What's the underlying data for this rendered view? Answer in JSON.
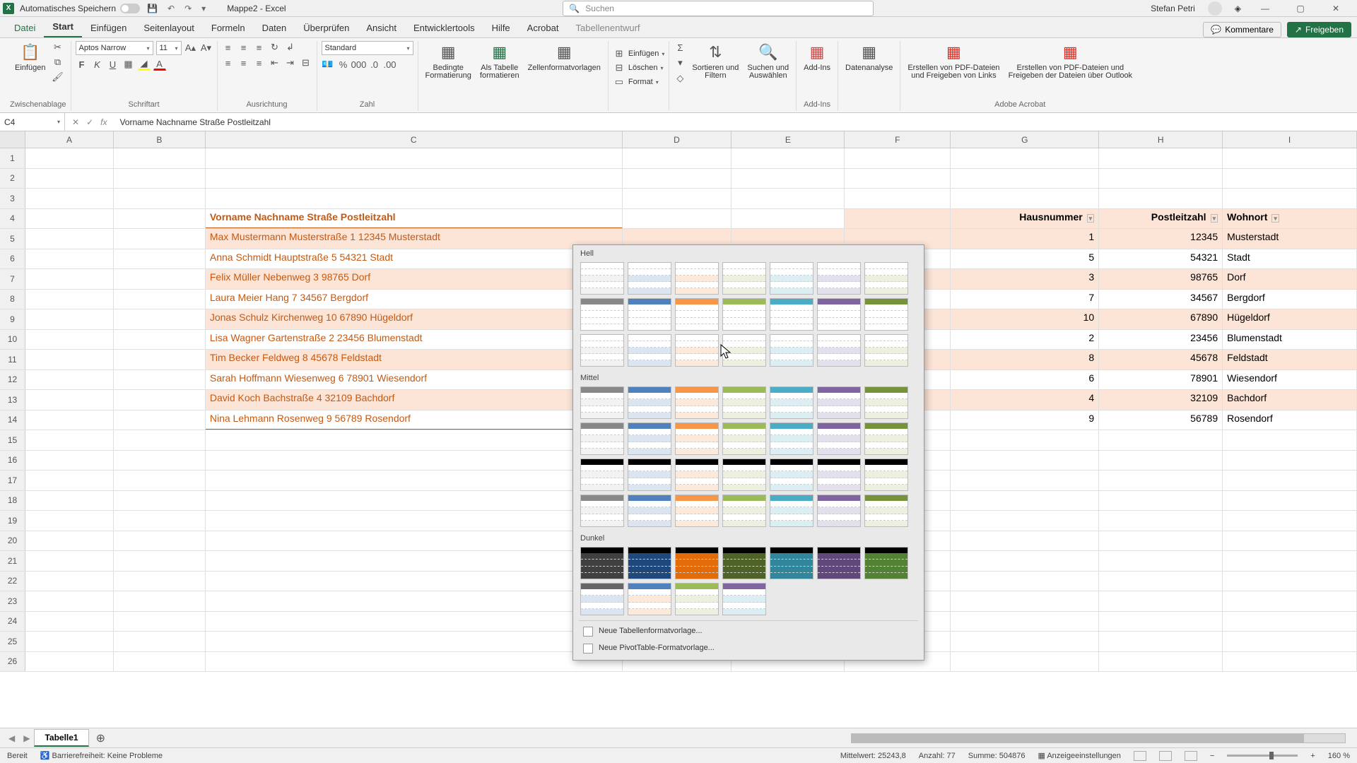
{
  "titlebar": {
    "autosave": "Automatisches Speichern",
    "doctitle": "Mappe2 - Excel",
    "search_placeholder": "Suchen",
    "user": "Stefan Petri"
  },
  "tabs": {
    "file": "Datei",
    "home": "Start",
    "insert": "Einfügen",
    "layout": "Seitenlayout",
    "formulas": "Formeln",
    "data": "Daten",
    "review": "Überprüfen",
    "view": "Ansicht",
    "dev": "Entwicklertools",
    "help": "Hilfe",
    "acrobat": "Acrobat",
    "tabledesign": "Tabellenentwurf",
    "comments": "Kommentare",
    "share": "Freigeben"
  },
  "ribbon": {
    "paste": "Einfügen",
    "clipboard": "Zwischenablage",
    "font": "Schriftart",
    "font_name": "Aptos Narrow",
    "font_size": "11",
    "align": "Ausrichtung",
    "number": "Zahl",
    "number_fmt": "Standard",
    "condfmt": "Bedingte\nFormatierung",
    "astable": "Als Tabelle\nformatieren",
    "cellstyles": "Zellenformatvorlagen",
    "cells_insert": "Einfügen",
    "cells_delete": "Löschen",
    "cells_format": "Format",
    "editing_sort": "Sortieren und\nFiltern",
    "editing_find": "Suchen und\nAuswählen",
    "addins": "Add-Ins",
    "analysis": "Datenanalyse",
    "pdf1": "Erstellen von PDF-Dateien\nund Freigeben von Links",
    "pdf2": "Erstellen von PDF-Dateien und\nFreigeben der Dateien über Outlook",
    "adobe": "Adobe Acrobat"
  },
  "formula": {
    "cell_ref": "C4",
    "content": "Vorname Nachname Straße Postleitzahl"
  },
  "columns": [
    "A",
    "B",
    "C",
    "D",
    "E",
    "F",
    "G",
    "H",
    "I"
  ],
  "table_headers": {
    "g": "Hausnummer",
    "h": "Postleitzahl",
    "i": "Wohnort"
  },
  "data_rows": [
    {
      "c": "Vorname Nachname Straße Postleitzahl",
      "g": "",
      "h": "",
      "i": "",
      "hdr": true
    },
    {
      "c": "Max Mustermann Musterstraße 1 12345 Musterstadt",
      "g": "1",
      "h": "12345",
      "i": "Musterstadt"
    },
    {
      "c": "Anna Schmidt Hauptstraße 5 54321 Stadt",
      "g": "5",
      "h": "54321",
      "i": "Stadt"
    },
    {
      "c": "Felix Müller Nebenweg 3 98765 Dorf",
      "g": "3",
      "h": "98765",
      "i": "Dorf"
    },
    {
      "c": "Laura Meier Hang 7 34567 Bergdorf",
      "g": "7",
      "h": "34567",
      "i": "Bergdorf"
    },
    {
      "c": "Jonas Schulz Kirchenweg 10 67890 Hügeldorf",
      "g": "10",
      "h": "67890",
      "i": "Hügeldorf"
    },
    {
      "c": "Lisa Wagner Gartenstraße 2 23456 Blumenstadt",
      "g": "2",
      "h": "23456",
      "i": "Blumenstadt"
    },
    {
      "c": "Tim Becker Feldweg 8 45678 Feldstadt",
      "g": "8",
      "h": "45678",
      "i": "Feldstadt"
    },
    {
      "c": "Sarah Hoffmann Wiesenweg 6 78901 Wiesendorf",
      "g": "6",
      "h": "78901",
      "i": "Wiesendorf"
    },
    {
      "c": "David Koch Bachstraße 4 32109 Bachdorf",
      "g": "4",
      "h": "32109",
      "i": "Bachdorf"
    },
    {
      "c": "Nina Lehmann Rosenweg 9 56789 Rosendorf",
      "g": "9",
      "h": "56789",
      "i": "Rosendorf"
    }
  ],
  "styles_panel": {
    "light": "Hell",
    "medium": "Mittel",
    "dark": "Dunkel",
    "new_table": "Neue Tabellenformatvorlage...",
    "new_pivot": "Neue PivotTable-Formatvorlage..."
  },
  "style_colors": {
    "light1": [
      "#ffffff",
      "#dbe5f1",
      "#fde9d9",
      "#ebf1de",
      "#daeef3",
      "#e4dfec",
      "#f2dcdb"
    ],
    "header_dark": [
      "#000000",
      "#1f497d",
      "#e26b0a",
      "#4f6228",
      "#31869b",
      "#60497a",
      "#963634"
    ],
    "medium": [
      "#808080",
      "#4f81bd",
      "#f79646",
      "#9bbb59",
      "#4bacc6",
      "#8064a2",
      "#c0504d"
    ],
    "dark": [
      "#404040",
      "#1f497d",
      "#e26b0a",
      "#4f6228",
      "#31869b",
      "#60497a",
      "#76933c"
    ]
  },
  "sheets": {
    "tab1": "Tabelle1"
  },
  "status": {
    "ready": "Bereit",
    "access": "Barrierefreiheit: Keine Probleme",
    "avg": "Mittelwert: 25243,8",
    "count": "Anzahl: 77",
    "sum": "Summe: 504876",
    "display": "Anzeigeeinstellungen",
    "zoom": "160 %"
  }
}
